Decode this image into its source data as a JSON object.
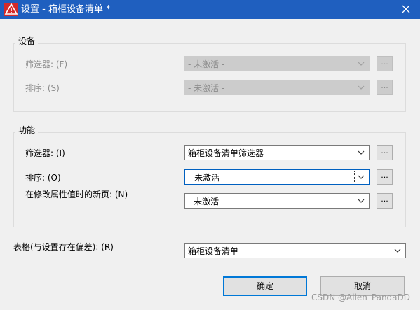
{
  "window": {
    "title": "设置 - 箱柜设备清单 *"
  },
  "groups": {
    "device": {
      "title": "设备",
      "filter": {
        "label": "筛选器: (F)",
        "value": "- 未激活 -",
        "button": "..."
      },
      "sort": {
        "label": "排序: (S)",
        "value": "- 未激活 -",
        "button": "..."
      }
    },
    "function": {
      "title": "功能",
      "filter": {
        "label": "筛选器: (I)",
        "value": "箱柜设备清单筛选器",
        "button": "..."
      },
      "sort": {
        "label": "排序: (O)",
        "value": "- 未激活 -",
        "button": "..."
      },
      "newpage": {
        "label": "在修改属性值时的新页: (N)",
        "value": "- 未激活 -",
        "button": "..."
      }
    }
  },
  "table": {
    "label": "表格(与设置存在偏差): (R)",
    "value": "箱柜设备清单"
  },
  "buttons": {
    "ok": "确定",
    "cancel": "取消"
  },
  "watermark": "CSDN @Allen_PandaDD",
  "colors": {
    "titlebar": "#1f5fbf",
    "focus": "#0078d7",
    "disabled_fill": "#cccccc"
  }
}
